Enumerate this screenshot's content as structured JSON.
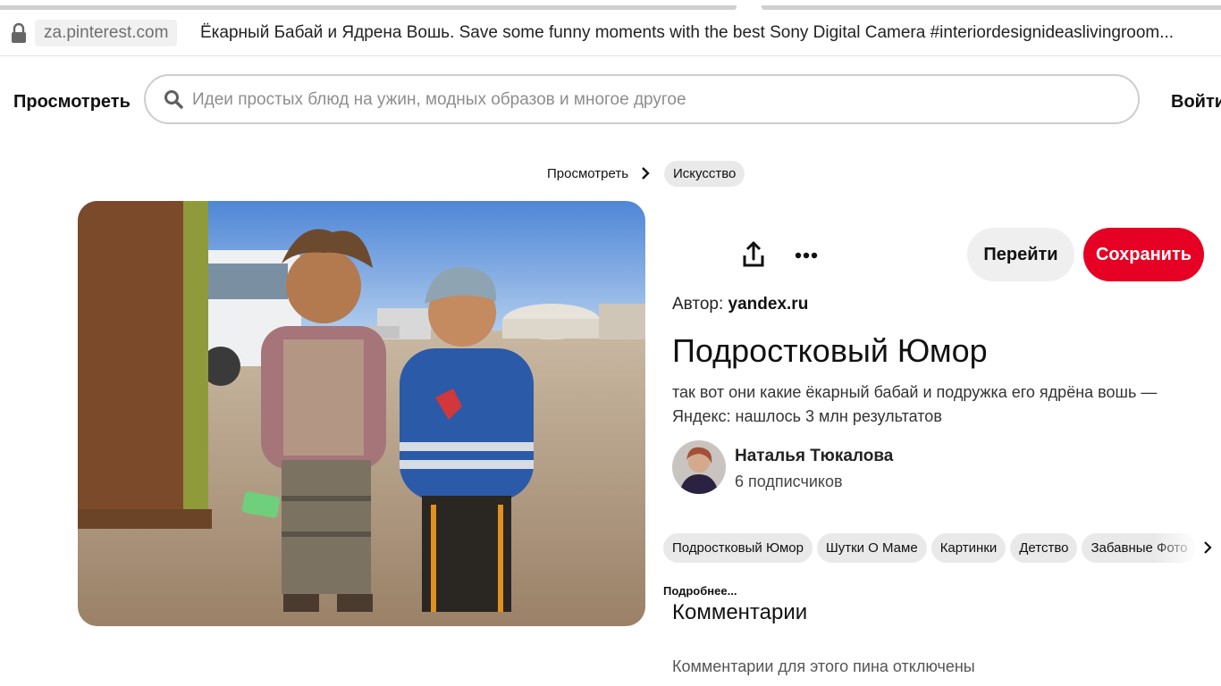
{
  "browser": {
    "domain": "za.pinterest.com",
    "page_title": "Ёкарный Бабай и Ядрена Вошь. Save some funny moments with the best Sony Digital Camera #interiordesignideaslivingroom..."
  },
  "header": {
    "browse_label": "Просмотреть",
    "search_placeholder": "Идеи простых блюд на ужин, модных образов и многое другое",
    "search_value": "",
    "login_label": "Войти"
  },
  "breadcrumb": {
    "browse": "Просмотреть",
    "category": "Искусство"
  },
  "actions": {
    "visit_label": "Перейти",
    "save_label": "Сохранить",
    "share_icon": "share-upload-icon",
    "more_icon": "ellipsis-icon"
  },
  "pin": {
    "author_prefix": "Автор:",
    "author_source": "yandex.ru",
    "title": "Подростковый Юмор",
    "description": "так вот они какие ёкарный бабай и подружка его ядрёна вошь — Яндекс: нашлось 3 млн результатов"
  },
  "user": {
    "name": "Наталья Тюкалова",
    "followers": "6 подписчиков"
  },
  "tags": [
    "Подростковый Юмор",
    "Шутки О Маме",
    "Картинки",
    "Детство",
    "Забавные Фото"
  ],
  "more_link": "Подробнее...",
  "comments": {
    "heading": "Комментарии",
    "disabled_text": "Комментарии для этого пина отключены"
  },
  "colors": {
    "save_red": "#e60023",
    "chip_gray": "#e9e9e9",
    "visit_gray": "#efefef"
  }
}
